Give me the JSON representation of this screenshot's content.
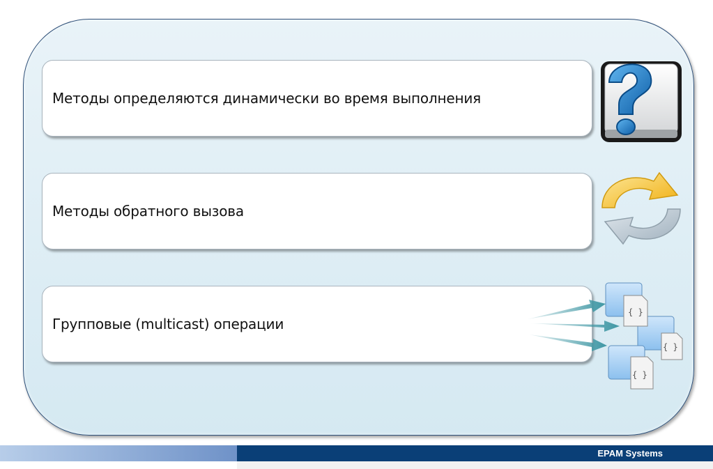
{
  "slide": {
    "items": [
      {
        "text": "Методы определяются динамически во время выполнения",
        "icon": "question-mark-icon"
      },
      {
        "text": "Методы обратного вызова",
        "icon": "refresh-arrows-icon"
      },
      {
        "text": "Групповые (multicast) операции",
        "icon": "multicast-code-icon"
      }
    ]
  },
  "footer": {
    "company": "EPAM Systems"
  },
  "colors": {
    "panel_border": "#2d4f78",
    "panel_fill": "#dcecf4",
    "footer_dark": "#0a3f77",
    "footer_light": "#6f92c8",
    "question_blue": "#1e7cc8",
    "arrow_yellow": "#f3c12e",
    "arrow_gray": "#b9c5cf",
    "multicast_arrow": "#3f97a4"
  }
}
